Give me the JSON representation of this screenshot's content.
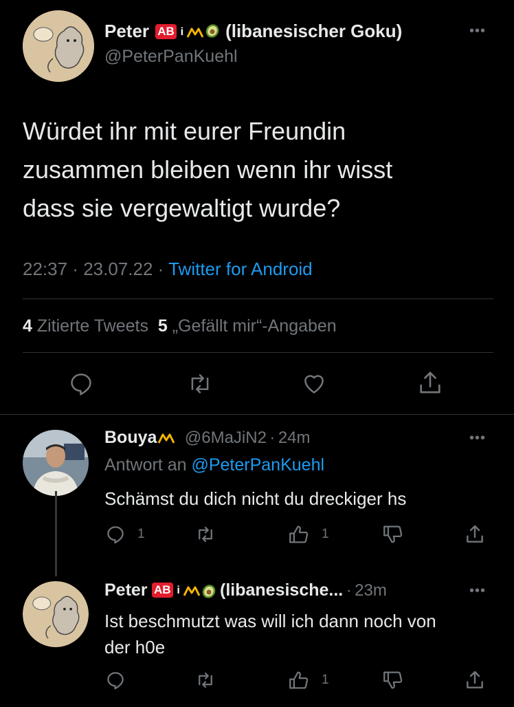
{
  "main_tweet": {
    "display_name": "Peter",
    "name_suffix": "(libanesischer Goku)",
    "handle": "@PeterPanKuehl",
    "text_lines": [
      "Würdet ihr mit eurer Freundin",
      "zusammen bleiben wenn ihr wisst",
      "dass sie vergewaltigt wurde?"
    ],
    "time": "22:37",
    "date": "23.07.22",
    "source": "Twitter for Android",
    "quote_count": "4",
    "quote_label": "Zitierte Tweets",
    "like_count": "5",
    "like_label": "„Gefällt mir“-Angaben",
    "menu": "•••"
  },
  "reply1": {
    "display_name": "Bouya",
    "handle": "@6MaJiN2",
    "age": "24m",
    "reply_prefix": "Antwort an",
    "reply_to": "@PeterPanKuehl",
    "text": "Schämst du dich nicht du dreckiger hs",
    "reply_count": "1",
    "like_count": "1",
    "menu": "•••"
  },
  "reply2": {
    "display_name": "Peter",
    "name_suffix": "(libanesische...",
    "age": "23m",
    "text_lines": [
      "Ist beschmutzt was will ich dann noch von",
      "der h0e"
    ],
    "like_count": "1",
    "menu": "•••"
  },
  "badges": {
    "ab": "AB",
    "i": "i"
  },
  "separator": "·",
  "colors": {
    "background": "#000000",
    "text": "#e7e9ea",
    "muted": "#71767b",
    "link": "#1d9bf0",
    "divider": "#2f3336"
  }
}
